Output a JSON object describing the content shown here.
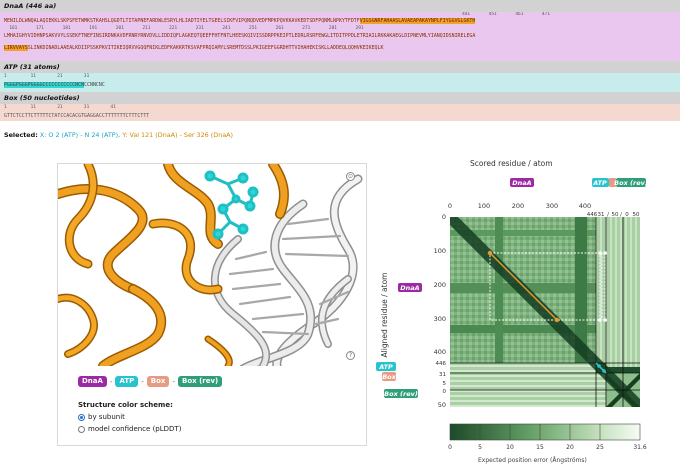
{
  "sequence_panel": {
    "sections": [
      {
        "title": "DnaA (446 aa)",
        "ruler_top": "                                                                                                                                                                            441       451       461       471",
        "ruler_mid": "  161       171       181       191       201       211       221       231       241       251       261       271       281       291",
        "line1_a": "MENILDLWNQALAQIEKKLSKPSFETWMKSTKAHSLQGDTLTITAPNEFARDWLESRYLHLIADTIYELTGEELSIKFVIPQNQDVEDFMPKPQVKKAVKEDTSDFPQNMLNPKYTFDTF",
        "line1_hl": "VIGSGNRFAHAASLAVAEAPAKAYNPLFIYGGVGLGKTH",
        "line2_a": "LMHAIGHYVIDHNPSAKVVYLSSEKFTNEFINSIRDNKAVDFRNRYRNVDVLLIDDIQFLAGKEQTQEEFFHTFNTLHEESKQIVISSDRPPKEIPTLEDRLRSRFEWGLITDITPPDLETRIAILRKKAKAEGLDIPNEVMLYIANQIDSNIRELEGA",
        "line3_hl": "LIRVVAYS",
        "line3_a": "SLINKDINADLAAEALKDIIPSSKPKVITIKEIQRVVGQQFNIKLEDFKAKKRTKSVAFPRQIAMYLSREMTDSSLPKIGEEFGGRDHTTVIHAHEKISKLLADDEQLQQHVKEIKEQLK"
      },
      {
        "title": "ATP (31 atoms)",
        "ruler": "1         11        21        31",
        "line_hl": "PGGGPGGGPGGGGCCCCCCCCCCCNCN",
        "line_a": "CCNNCNC"
      },
      {
        "title": "Box (50 nucleotides)",
        "ruler": "1         11        21        31        41",
        "line": "GTTCTCCTTCTTTTTCTATCCACACGTGAGGACCTTTTTTTCTTTCTTT"
      }
    ],
    "selected": {
      "label": "Selected:",
      "x_text": "X: O 2 (ATP) - N 24 (ATP),",
      "y_text": "Y: Val 121 (DnaA) - Ser 326 (DnaA)"
    }
  },
  "viewer": {
    "camera_icon": "camera-icon",
    "help_icon": "help-icon",
    "chips": [
      "DnaA",
      "ATP",
      "Box",
      "Box (rev)"
    ],
    "chip_colors": [
      "#9c2aa4",
      "#27c4cf",
      "#e69b82",
      "#2f9e7a"
    ],
    "chip_sep": "-",
    "scheme_title": "Structure color scheme:",
    "options": [
      {
        "label": "by subunit",
        "selected": true
      },
      {
        "label": "model confidence (pLDDT)",
        "selected": false
      }
    ]
  },
  "pae": {
    "title": "Scored residue / atom",
    "ylabel": "Aligned residue / atom",
    "top_ticks": [
      "0",
      "100",
      "200",
      "300",
      "400",
      "446",
      "31",
      "/",
      "50",
      "/",
      "0",
      "50"
    ],
    "left_ticks": [
      "0",
      "100",
      "200",
      "300",
      "400",
      "446",
      "31",
      "5",
      "0",
      "50"
    ],
    "chain_labels": {
      "dnaa": "DnaA",
      "atp": "ATP",
      "box": "Box",
      "box_rev": "Box (rev)"
    },
    "colorbar": {
      "ticks": [
        "0",
        "5",
        "10",
        "15",
        "20",
        "25",
        "31.6"
      ],
      "label": "Expected position error (Ångströms)"
    },
    "colors": {
      "dark": "#1e4d2b",
      "mid": "#5f9e64",
      "light": "#eef7ea",
      "select": "#e89a2e"
    }
  }
}
